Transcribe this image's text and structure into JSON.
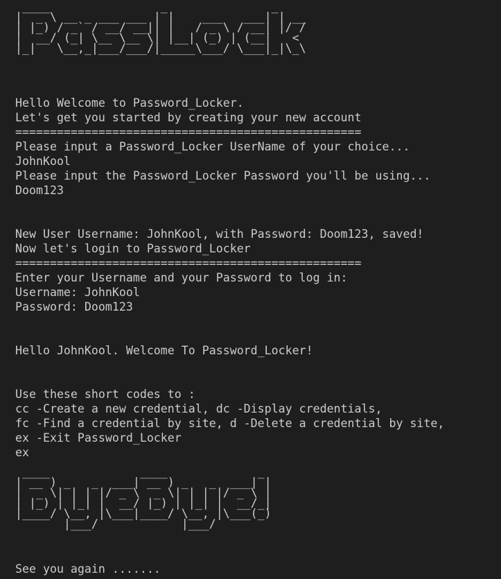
{
  "banner_top": [
    " ____                _               _    ",
    "|  _ \\ __ _ ___ ___ | |    ___   ___| | __",
    "| |_) / _` / __/ __|| |   / _ \\ / __| |/ /",
    "|  __/ (_| \\__ \\__ \\| |__| (_) | (__|   < ",
    "|_|   \\__,_|___/___/|_____\\___/ \\___|_|\\_\\"
  ],
  "lines": [
    "Hello Welcome to Password_Locker.",
    "Let's get you started by creating your new account",
    "==================================================",
    "Please input a Password_Locker UserName of your choice...",
    "JohnKool",
    "Please input the Password_Locker Password you'll be using...",
    "Doom123",
    "New User Username: JohnKool, with Password: Doom123, saved!",
    "Now let's login to Password_Locker",
    "==================================================",
    "Enter your Username and your Password to log in:",
    "Username: JohnKool",
    "Password: Doom123",
    "Hello JohnKool. Welcome To Password_Locker!",
    "Use these short codes to :",
    "cc -Create a new credential, dc -Display credentials,",
    "fc -Find a credential by site, d -Delete a credential by site,",
    "ex -Exit Password_Locker",
    "ex",
    "See you again ......."
  ],
  "banner_bottom": [
    " ____             ____             _ ",
    "| __ ) _   _  ___| __ ) _   _  ___| |",
    "|  _ \\| | | |/ _ \\  _ \\| | | |/ _ \\ |",
    "| |_) | |_| |  __/ |_) | |_| |  __/_|",
    "|____/ \\__, |\\___|____/ \\__, |\\___(_)",
    "       |___/            |___/        "
  ]
}
